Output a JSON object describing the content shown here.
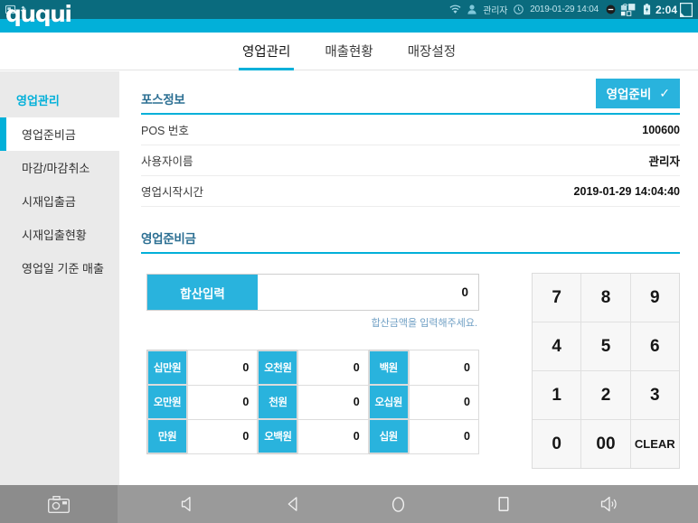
{
  "statusbar": {
    "left_icons": [
      "screenshot-icon",
      "usb-icon"
    ],
    "wifi_icon": "wifi-icon",
    "user_icon": "user-icon",
    "user": "관리자",
    "clock_icon": "clock-icon",
    "datetime": "2019-01-29 14:04",
    "remove_icon": "remove-circle-icon",
    "apps_icon": "apps-icon",
    "battery_icon": "battery-icon",
    "time": "2:04",
    "note_icon": "note-icon"
  },
  "header": {
    "logo": "ququi"
  },
  "tabs": [
    {
      "label": "영업관리",
      "active": true
    },
    {
      "label": "매출현황",
      "active": false
    },
    {
      "label": "매장설정",
      "active": false
    }
  ],
  "sidebar": {
    "title": "영업관리",
    "items": [
      {
        "label": "영업준비금",
        "active": true
      },
      {
        "label": "마감/마감취소",
        "active": false
      },
      {
        "label": "시재입출금",
        "active": false
      },
      {
        "label": "시재입출현황",
        "active": false
      },
      {
        "label": "영업일 기준 매출",
        "active": false
      }
    ]
  },
  "pos_info": {
    "section_title": "포스정보",
    "ready_button": "영업준비",
    "check_glyph": "✓",
    "rows": [
      {
        "label": "POS 번호",
        "value": "100600"
      },
      {
        "label": "사용자이름",
        "value": "관리자"
      },
      {
        "label": "영업시작시간",
        "value": "2019-01-29 14:04:40"
      }
    ]
  },
  "opening_cash": {
    "section_title": "영업준비금",
    "sum_button": "합산입력",
    "sum_value": "0",
    "hint": "합산금액을 입력해주세요.",
    "denominations": [
      [
        {
          "label": "십만원",
          "value": "0"
        },
        {
          "label": "오천원",
          "value": "0"
        },
        {
          "label": "백원",
          "value": "0"
        }
      ],
      [
        {
          "label": "오만원",
          "value": "0"
        },
        {
          "label": "천원",
          "value": "0"
        },
        {
          "label": "오십원",
          "value": "0"
        }
      ],
      [
        {
          "label": "만원",
          "value": "0"
        },
        {
          "label": "오백원",
          "value": "0"
        },
        {
          "label": "십원",
          "value": "0"
        }
      ]
    ]
  },
  "keypad": {
    "keys": [
      "7",
      "8",
      "9",
      "4",
      "5",
      "6",
      "1",
      "2",
      "3",
      "0",
      "00",
      "CLEAR"
    ]
  },
  "navbar": {
    "buttons": [
      "camera-icon",
      "volume-down-icon",
      "back-icon",
      "home-icon",
      "recents-icon",
      "volume-up-icon"
    ]
  },
  "colors": {
    "status_teal": "#0a6b7e",
    "accent_cyan": "#02b0d9",
    "button_cyan": "#29b3dd",
    "sidebar_gray": "#eaeaea",
    "nav_gray": "#9a9a9a"
  }
}
